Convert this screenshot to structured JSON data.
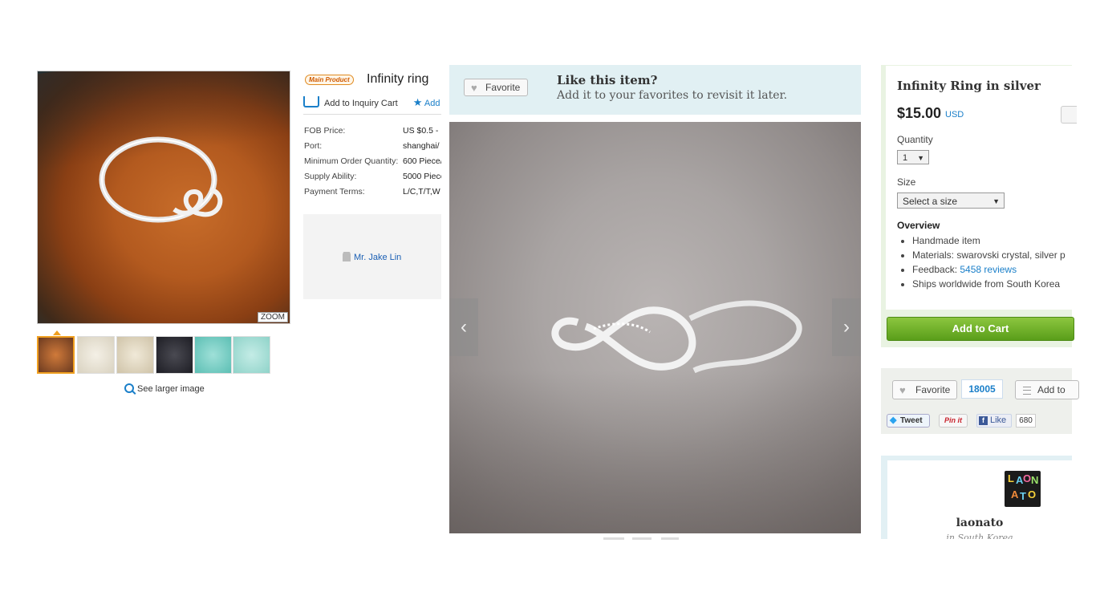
{
  "left_panel": {
    "zoom_label": "ZOOM",
    "see_larger": "See larger image",
    "thumbnail_count": 6
  },
  "product_info": {
    "badge": "Main Product",
    "title": "Infinity ring",
    "add_inquiry_cart": "Add to Inquiry Cart",
    "add_favorites": "Add",
    "specs": [
      {
        "label": "FOB Price:",
        "value": "US $0.5 -"
      },
      {
        "label": "Port:",
        "value": "shanghai/"
      },
      {
        "label": "Minimum Order Quantity:",
        "value": "600 Piece/"
      },
      {
        "label": "Supply Ability:",
        "value": "5000 Piece"
      },
      {
        "label": "Payment Terms:",
        "value": "L/C,T/T,W"
      }
    ],
    "contact_name": "Mr. Jake Lin"
  },
  "favorite_banner": {
    "button_label": "Favorite",
    "title": "Like this item?",
    "subtitle": "Add it to your favorites to revisit it later."
  },
  "gallery": {
    "prev_icon": "‹",
    "next_icon": "›"
  },
  "buy_box": {
    "title": "Infinity Ring in silver",
    "price": "$15.00",
    "currency": "USD",
    "quantity_label": "Quantity",
    "quantity_value": "1",
    "size_label": "Size",
    "size_placeholder": "Select a size",
    "overview_title": "Overview",
    "overview_items": [
      {
        "text": "Handmade item"
      },
      {
        "text": "Materials: swarovski crystal, silver p"
      },
      {
        "prefix": "Feedback: ",
        "link": "5458 reviews"
      },
      {
        "text": "Ships worldwide from South Korea"
      }
    ],
    "add_to_cart": "Add to Cart"
  },
  "social": {
    "favorite_label": "Favorite",
    "favorite_count": "18005",
    "add_to_label": "Add to",
    "tweet_label": "Tweet",
    "pinit_label": "Pin it",
    "like_label": "Like",
    "like_count": "680"
  },
  "shop": {
    "logo_letters": [
      "L",
      "A",
      "O",
      "N",
      "A",
      "T",
      "O"
    ],
    "name": "laonato",
    "location": "in South Korea"
  },
  "colors": {
    "accent_blue": "#1a7fc9",
    "cart_green": "#6aae23",
    "badge_orange": "#e08a20"
  }
}
